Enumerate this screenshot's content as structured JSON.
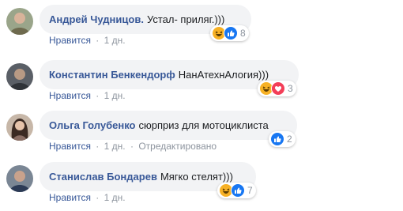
{
  "comments": [
    {
      "author": "Андрей Чудницов.",
      "text": "Устал- приляг.)))",
      "like_label": "Нравится",
      "time": "1 дн.",
      "edited": "",
      "reaction_icons": [
        "haha-icon",
        "like-icon"
      ],
      "reaction_count": "8"
    },
    {
      "author": "Константин Бенкендорф",
      "text": "НанАтехнАлогия)))",
      "like_label": "Нравится",
      "time": "1 дн.",
      "edited": "",
      "reaction_icons": [
        "haha-icon",
        "love-icon"
      ],
      "reaction_count": "3"
    },
    {
      "author": "Ольга Голубенко",
      "text": "сюрприз для мотоциклиста",
      "like_label": "Нравится",
      "time": "1 дн.",
      "edited": "Отредактировано",
      "reaction_icons": [
        "like-icon"
      ],
      "reaction_count": "2"
    },
    {
      "author": "Станислав Бондарев",
      "text": "Мягко стелят)))",
      "like_label": "Нравится",
      "time": "1 дн.",
      "edited": "",
      "reaction_icons": [
        "haha-icon",
        "like-icon"
      ],
      "reaction_count": "7"
    }
  ],
  "separator": "·",
  "colors": {
    "author": "#385898",
    "bubble": "#f2f3f5",
    "meta": "#8d949e",
    "like_blue": "#1877f2",
    "love_red": "#f33e58",
    "haha_yellow": "#f7b125"
  }
}
